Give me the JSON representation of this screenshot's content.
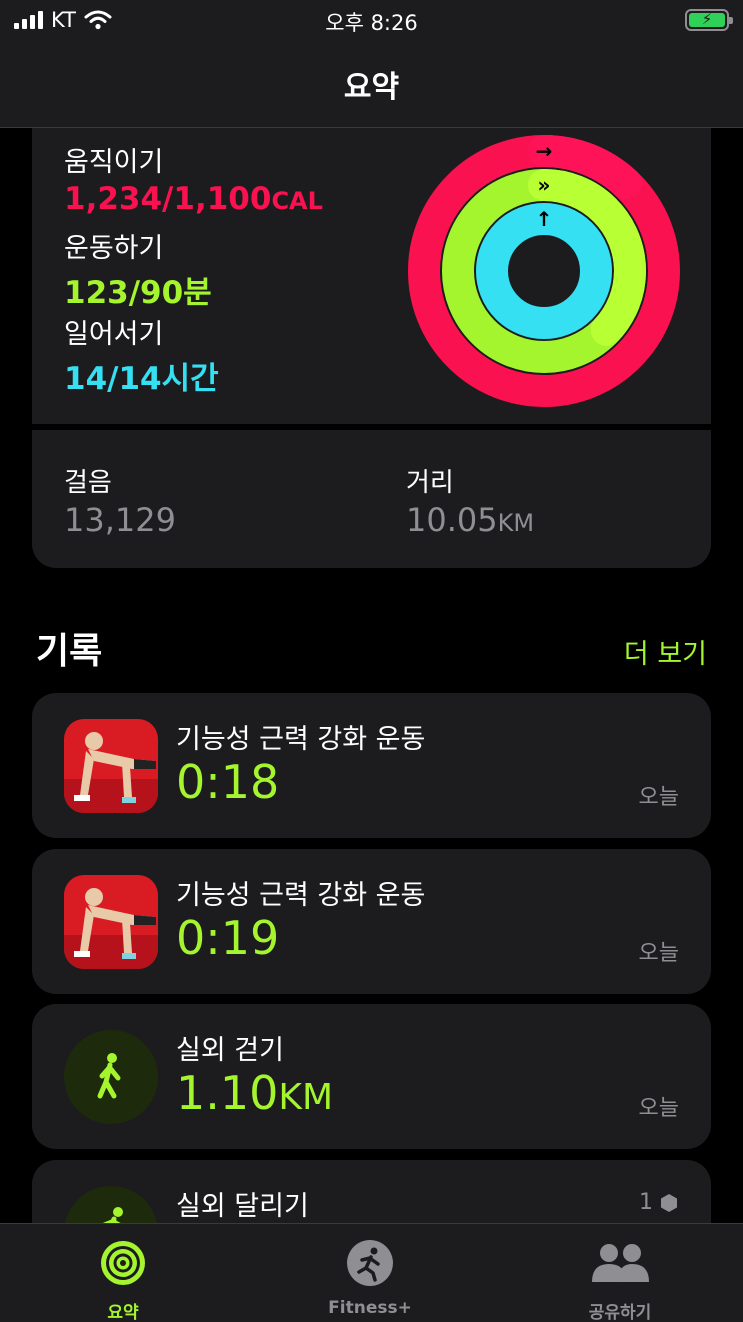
{
  "status_bar": {
    "carrier": "KT",
    "time": "오후 8:26"
  },
  "header": {
    "title": "요약"
  },
  "activity": {
    "move": {
      "label": "움직이기",
      "value": "1,234/1,100",
      "unit": "CAL",
      "color": "#fa114f",
      "progress": 1.12
    },
    "exercise": {
      "label": "운동하기",
      "value": "123/90분",
      "color": "#a4f52e",
      "progress": 1.37
    },
    "stand": {
      "label": "일어서기",
      "value": "14/14시간",
      "color": "#34e0f2",
      "progress": 1.0
    }
  },
  "steps": {
    "label": "걸음",
    "value": "13,129"
  },
  "distance": {
    "label": "거리",
    "value": "10.05",
    "unit": "KM"
  },
  "history": {
    "title": "기록",
    "more_label": "더 보기",
    "workouts": [
      {
        "name": "기능성 근력 강화 운동",
        "value": "0:18",
        "unit": "",
        "date": "오늘",
        "icon": "pushup-icon"
      },
      {
        "name": "기능성 근력 강화 운동",
        "value": "0:19",
        "unit": "",
        "date": "오늘",
        "icon": "pushup-icon"
      },
      {
        "name": "실외 걷기",
        "value": "1.10",
        "unit": "KM",
        "date": "오늘",
        "icon": "walk-icon"
      },
      {
        "name": "실외 달리기",
        "count": "1",
        "icon": "run-icon"
      }
    ]
  },
  "tabs": [
    {
      "label": "요약",
      "icon": "summary-rings-icon",
      "active": true
    },
    {
      "label": "Fitness+",
      "icon": "fitness-plus-runner-icon",
      "active": false
    },
    {
      "label": "공유하기",
      "icon": "sharing-people-icon",
      "active": false
    }
  ]
}
